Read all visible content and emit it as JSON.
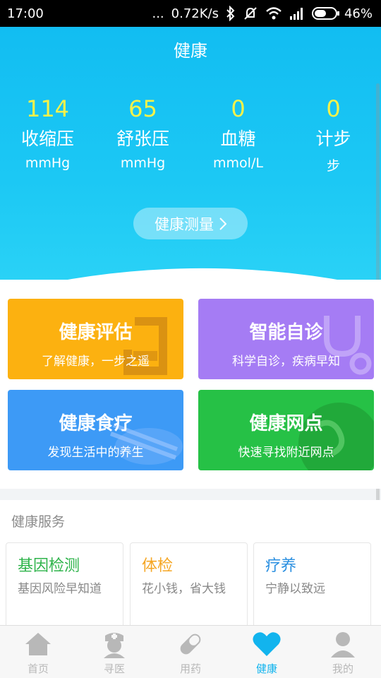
{
  "status": {
    "time": "17:00",
    "dots": "...",
    "speed": "0.72K/s",
    "battery": "46%"
  },
  "header": {
    "title": "健康"
  },
  "metrics": [
    {
      "value": "114",
      "name": "收缩压",
      "unit": "mmHg"
    },
    {
      "value": "65",
      "name": "舒张压",
      "unit": "mmHg"
    },
    {
      "value": "0",
      "name": "血糖",
      "unit": "mmol/L"
    },
    {
      "value": "0",
      "name": "计步",
      "unit": "步"
    }
  ],
  "measure_button": {
    "label": "健康测量"
  },
  "cards": {
    "eval": {
      "title": "健康评估",
      "sub": "了解健康，一步之遥"
    },
    "diag": {
      "title": "智能自诊",
      "sub": "科学自诊，疾病早知"
    },
    "diet": {
      "title": "健康食疗",
      "sub": "发现生活中的养生"
    },
    "net": {
      "title": "健康网点",
      "sub": "快速寻找附近网点"
    }
  },
  "services": {
    "title": "健康服务",
    "items": [
      {
        "title": "基因检测",
        "sub": "基因风险早知道",
        "color": "#2db34a"
      },
      {
        "title": "体检",
        "sub": "花小钱，省大钱",
        "color": "#f5a623"
      },
      {
        "title": "疗养",
        "sub": "宁静以致远",
        "color": "#2a8fe0"
      }
    ]
  },
  "nav": [
    {
      "label": "首页",
      "icon": "home-icon"
    },
    {
      "label": "寻医",
      "icon": "doctor-icon"
    },
    {
      "label": "用药",
      "icon": "pill-icon"
    },
    {
      "label": "健康",
      "icon": "heart-icon",
      "active": true
    },
    {
      "label": "我的",
      "icon": "user-icon"
    }
  ],
  "colors": {
    "accent": "#12b4ee",
    "metric_value": "#f6f24a"
  }
}
